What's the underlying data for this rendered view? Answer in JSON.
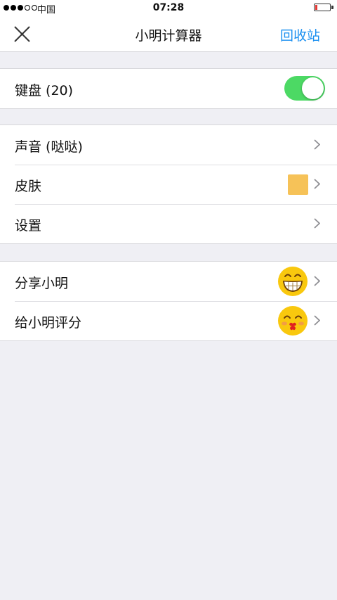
{
  "status_bar": {
    "carrier": "中国",
    "time": "07:28",
    "signal_bars": 3,
    "signal_total": 5
  },
  "nav": {
    "title": "小明计算器",
    "action": "回收站"
  },
  "settings": {
    "keyboard_label": "键盘 (20)",
    "keyboard_enabled": true,
    "sound_label": "声音 (哒哒)",
    "skin_label": "皮肤",
    "skin_color": "#f6c258",
    "settings_label": "设置",
    "share_label": "分享小明",
    "rate_label": "给小明评分"
  },
  "icons": {
    "close": "close-icon",
    "chevron": "chevron-right-icon",
    "grin_emoji": "grinning-emoji",
    "kiss_emoji": "kissing-emoji"
  },
  "colors": {
    "accent": "#1a8ff0",
    "toggle_on": "#4cd964",
    "battery_low": "#e53935",
    "emoji_yellow": "#f9c80e"
  }
}
